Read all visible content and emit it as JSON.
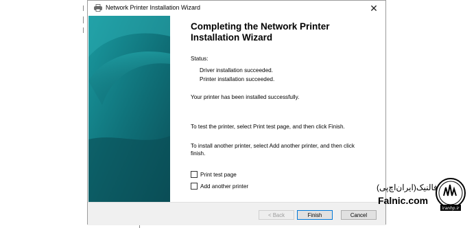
{
  "window": {
    "title": "Network Printer Installation Wizard",
    "close_glyph": "✕"
  },
  "wizard": {
    "heading": "Completing the Network Printer Installation Wizard",
    "status_label": "Status:",
    "status_lines": [
      "Driver installation succeeded.",
      "Printer installation succeeded."
    ],
    "installed_message": "Your printer has been installed successfully.",
    "test_instruction": "To test the printer, select Print test page, and then click Finish.",
    "another_instruction": "To install another printer, select Add another printer, and then click finish.",
    "checkboxes": [
      {
        "label": "Print test page",
        "checked": false
      },
      {
        "label": "Add another printer",
        "checked": false
      }
    ]
  },
  "buttons": {
    "back": "< Back",
    "finish": "Finish",
    "cancel": "Cancel"
  },
  "watermark": {
    "persian": "فالنیک(ایران‌اچ‌پی)",
    "site": "Falnic.com",
    "logo_text": "iranhp.ir"
  },
  "colors": {
    "panel_dark": "#0b5660",
    "panel_light": "#1a8f93",
    "default_button_border": "#0078d7"
  }
}
